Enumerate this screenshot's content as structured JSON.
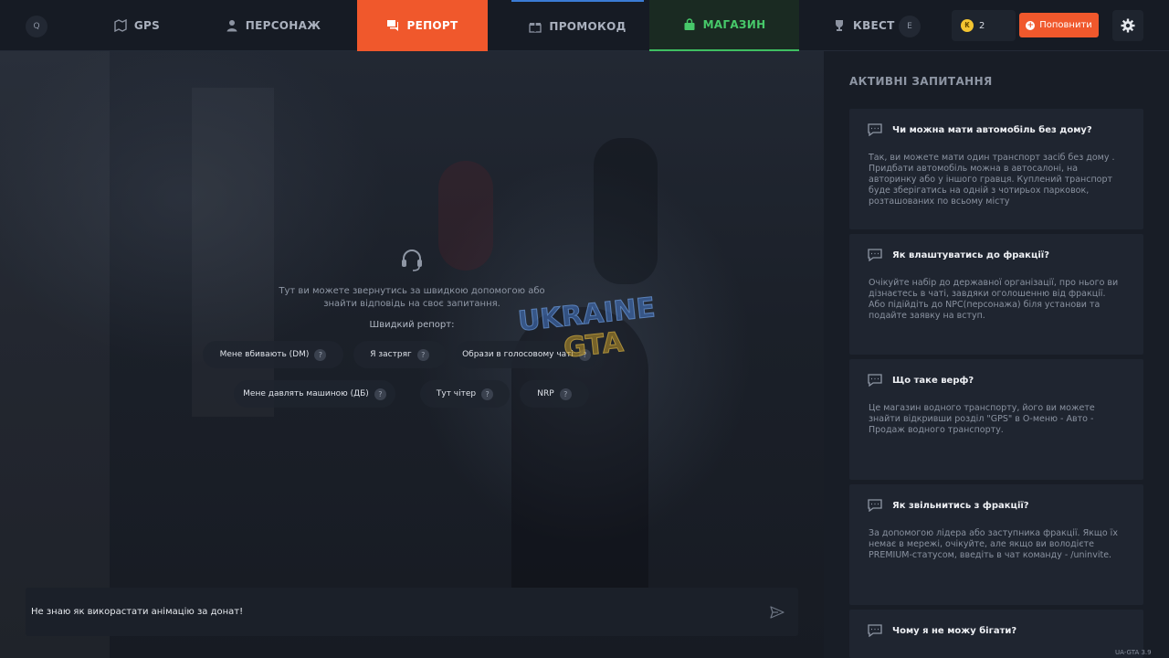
{
  "nav": {
    "key_left": "Q",
    "key_right": "E",
    "tabs": [
      {
        "label": "GPS",
        "icon": "map-icon"
      },
      {
        "label": "ПЕРСОНАЖ",
        "icon": "person-icon"
      },
      {
        "label": "РЕПОРТ",
        "icon": "chat-icon",
        "active": true
      },
      {
        "label": "ПРОМОКОД",
        "icon": "gift-icon"
      },
      {
        "label": "МАГАЗИН",
        "icon": "bag-icon"
      },
      {
        "label": "КВЕСТ",
        "icon": "trophy-icon"
      }
    ],
    "coins": "2",
    "topup_label": "Поповнити"
  },
  "report": {
    "intro": "Тут ви можете звернутись за швидкою допомогою або знайти відповідь на своє запитання.",
    "quick_title": "Швидкий репорт:",
    "chips": [
      "Мене вбивають (DM)",
      "Я застряг",
      "Образи в голосовому чаті",
      "Мене давлять машиною (ДБ)",
      "Тут чітер",
      "NRP"
    ],
    "input_value": "Не знаю як викорастати анімацію за донат!",
    "logo_line1": "UKRAINE",
    "logo_line2": "GTA"
  },
  "faq": {
    "title": "АКТИВНІ ЗАПИТАННЯ",
    "items": [
      {
        "q": "Чи можна мати автомобіль без дому?",
        "a": "Так, ви можете мати один транспорт засіб без дому . Придбати автомобіль можна в автосалоні, на авторинку або у іншого гравця. Куплений транспорт буде зберігатись на одній з чотирьох парковок, розташованих по всьому місту"
      },
      {
        "q": "Як влаштуватись до фракції?",
        "a": "Очікуйте набір до державної організації, про нього ви дізнаєтесь в чаті, завдяки оголошенню від фракції. Або підійдіть до NPC(персонажа) біля установи та подайте заявку на вступ."
      },
      {
        "q": "Що таке верф?",
        "a": "Це магазин водного транспорту, його ви можете знайти відкривши розділ \"GPS\" в О-меню - Авто - Продаж водного транспорту."
      },
      {
        "q": "Як звільнитись з фракції?",
        "a": "За допомогою лідера або заступника фракції. Якщо їх немає в мережі, очікуйте, але якщо ви володієте PREMIUM-статусом, введіть в чат команду - /uninvite."
      },
      {
        "q": "Чому я не можу бігати?",
        "a": ""
      }
    ]
  },
  "version": "UA-GTA 3.9",
  "colors": {
    "accent": "#f0582c",
    "shop_green": "#3fbf62",
    "coin": "#f4c531"
  }
}
